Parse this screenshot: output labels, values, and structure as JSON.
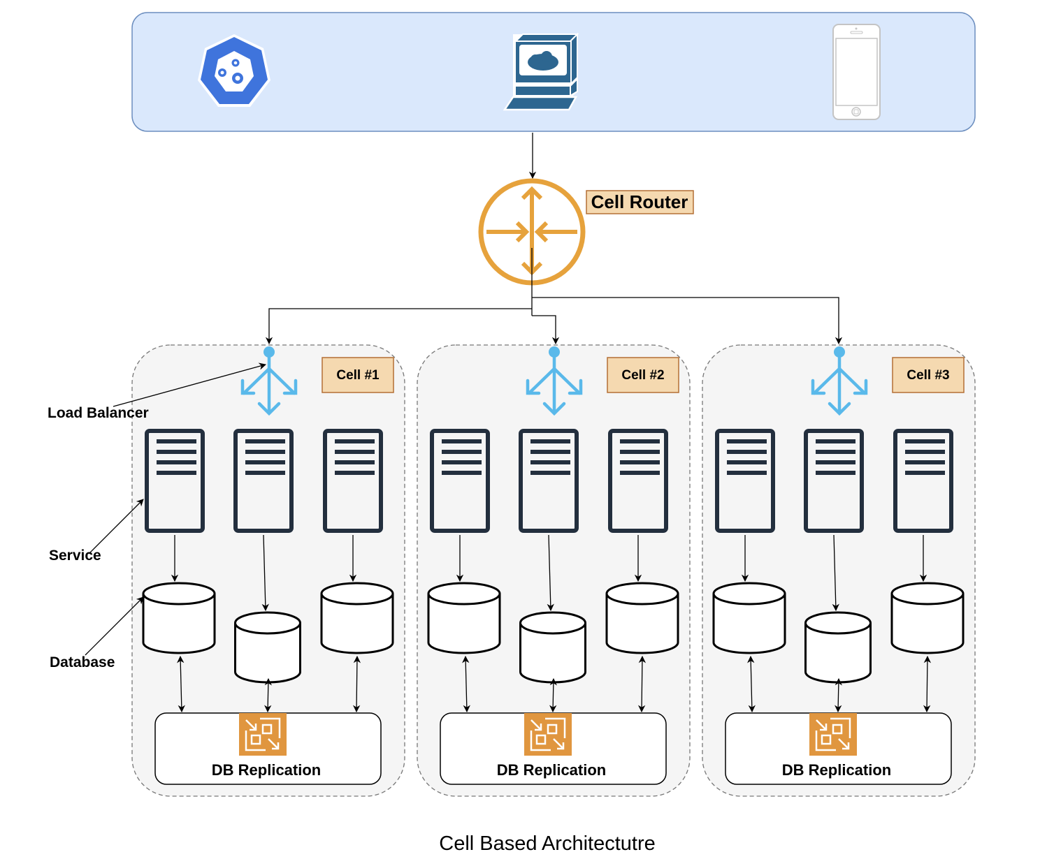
{
  "title": "Cell Based Architectutre",
  "clients": {
    "items": [
      {
        "name": "kubernetes-client",
        "icon": "kubernetes-icon"
      },
      {
        "name": "desktop-client",
        "icon": "computer-cloud-icon"
      },
      {
        "name": "mobile-client",
        "icon": "mobile-phone-icon"
      }
    ]
  },
  "router": {
    "label": "Cell Router",
    "icon": "router-icon"
  },
  "annotations": {
    "load_balancer": "Load Balancer",
    "service": "Service",
    "database": "Database"
  },
  "cells": [
    {
      "label": "Cell #1",
      "replication_label": "DB Replication",
      "services": 3,
      "databases": 3
    },
    {
      "label": "Cell #2",
      "replication_label": "DB Replication",
      "services": 3,
      "databases": 3
    },
    {
      "label": "Cell #3",
      "replication_label": "DB Replication",
      "services": 3,
      "databases": 3
    }
  ],
  "colors": {
    "client_bg": "#dae8fc",
    "client_border": "#6c8ebf",
    "router": "#e6a23c",
    "label_bg": "#f5d9b0",
    "label_border": "#b46f35",
    "cell_bg": "#f5f5f5",
    "load_balancer": "#5ab9ea",
    "server": "#232f3e",
    "replication": "#e0963f",
    "k8s": "#3f74dc",
    "desktop": "#2d6690"
  }
}
